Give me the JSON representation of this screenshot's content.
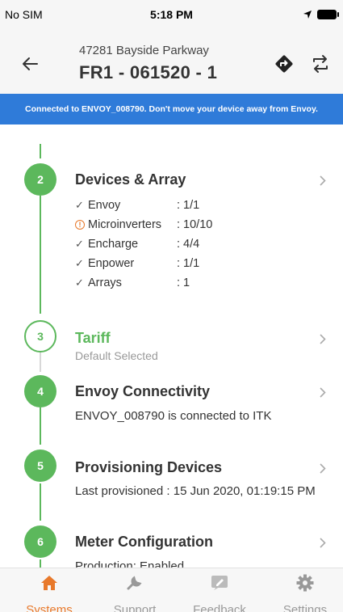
{
  "status_bar": {
    "carrier": "No SIM",
    "time": "5:18 PM"
  },
  "header": {
    "subtitle": "47281 Bayside Parkway",
    "title": "FR1 - 061520 - 1"
  },
  "banner": {
    "text": "Connected to ENVOY_008790. Don't move your device away from Envoy."
  },
  "steps": [
    {
      "number": "2",
      "title": "Devices & Array",
      "items": [
        {
          "icon": "check-icon",
          "name": "Envoy",
          "value": ": 1/1"
        },
        {
          "icon": "warning-icon",
          "name": "Microinverters",
          "value": ": 10/10"
        },
        {
          "icon": "check-icon",
          "name": "Encharge",
          "value": ": 4/4"
        },
        {
          "icon": "check-icon",
          "name": "Enpower",
          "value": ": 1/1"
        },
        {
          "icon": "check-icon",
          "name": "Arrays",
          "value": ": 1"
        }
      ]
    },
    {
      "number": "3",
      "title": "Tariff",
      "subtitle": "Default Selected"
    },
    {
      "number": "4",
      "title": "Envoy Connectivity",
      "subtitle": "ENVOY_008790 is connected to ITK"
    },
    {
      "number": "5",
      "title": "Provisioning Devices",
      "subtitle": "Last provisioned : 15 Jun 2020, 01:19:15 PM"
    },
    {
      "number": "6",
      "title": "Meter Configuration",
      "subtitle": "Production: Enabled"
    }
  ],
  "tabs": [
    {
      "label": "Systems",
      "icon": "home-icon",
      "active": true
    },
    {
      "label": "Support",
      "icon": "wrench-icon",
      "active": false
    },
    {
      "label": "Feedback",
      "icon": "feedback-icon",
      "active": false
    },
    {
      "label": "Settings",
      "icon": "gear-icon",
      "active": false
    }
  ],
  "colors": {
    "accent": "#5cb85c",
    "banner": "#2f7bd9",
    "active_tab": "#e8792b",
    "warning": "#e8792b"
  }
}
